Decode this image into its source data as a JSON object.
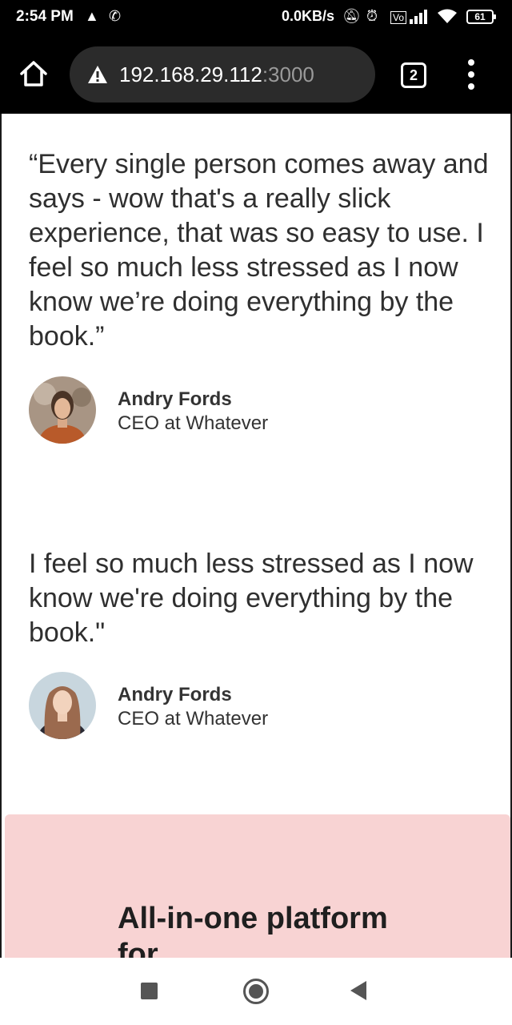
{
  "status_bar": {
    "time": "2:54 PM",
    "network_speed": "0.0KB/s",
    "battery": "61"
  },
  "browser": {
    "url_host": "192.168.29.112",
    "url_port": ":3000",
    "tab_count": "2"
  },
  "testimonials": [
    {
      "quote": "“Every single person comes away and says - wow that's a really slick experience, that was so easy to use. I feel so much less stressed as I now know we’re doing everything by the book.”",
      "name": "Andry Fords",
      "role": "CEO at Whatever"
    },
    {
      "quote": "I feel so much less stressed as I now know we're doing everything by the book.\"",
      "name": "Andry Fords",
      "role": "CEO at Whatever"
    }
  ],
  "cta": {
    "title": "All-in-one platform for"
  },
  "colors": {
    "cta_background": "#f8d3d3",
    "text": "#2f2f2f",
    "url_pill": "#2b2b2b"
  }
}
